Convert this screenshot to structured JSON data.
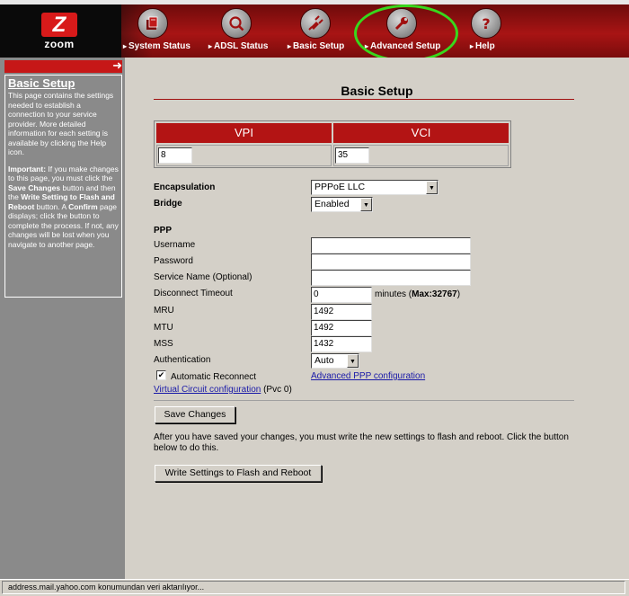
{
  "brand": {
    "logo_letter": "Z",
    "logo_word": "zoom"
  },
  "nav": [
    {
      "label": "System Status",
      "icon": "document-folder-icon"
    },
    {
      "label": "ADSL Status",
      "icon": "magnifier-icon"
    },
    {
      "label": "Basic Setup",
      "icon": "plug-icon"
    },
    {
      "label": "Advanced Setup",
      "icon": "wrench-icon"
    },
    {
      "label": "Help",
      "icon": "question-icon"
    }
  ],
  "sidebar": {
    "title": "Basic Setup",
    "intro": "This page contains the settings needed to establish a connection to your service provider. More detailed information for each setting is available by clicking the Help icon.",
    "important_label": "Important:",
    "important_1": " If you make changes to this page, you must click the ",
    "save_ref": "Save Changes",
    "important_2": " button and then the ",
    "write_ref": "Write Setting to Flash and Reboot",
    "important_3": " button. A ",
    "confirm_ref": "Confirm",
    "important_4": " page displays; click the button to complete the process. If not, any changes will be lost when you navigate to another page."
  },
  "main": {
    "title": "Basic Setup",
    "vpi_label": "VPI",
    "vpi_value": "8",
    "vci_label": "VCI",
    "vci_value": "35",
    "encapsulation_label": "Encapsulation",
    "encapsulation_value": "PPPoE LLC",
    "bridge_label": "Bridge",
    "bridge_value": "Enabled",
    "ppp_heading": "PPP",
    "username_label": "Username",
    "username_value": "",
    "password_label": "Password",
    "password_value": "",
    "service_label": "Service Name (Optional)",
    "service_value": "",
    "timeout_label": "Disconnect Timeout",
    "timeout_value": "0",
    "timeout_units": "minutes (",
    "timeout_max": "Max:32767",
    "timeout_close": ")",
    "mru_label": "MRU",
    "mru_value": "1492",
    "mtu_label": "MTU",
    "mtu_value": "1492",
    "mss_label": "MSS",
    "mss_value": "1432",
    "auth_label": "Authentication",
    "auth_value": "Auto",
    "auto_reconnect_label": "Automatic Reconnect",
    "auto_reconnect_checked": "✔",
    "advanced_ppp_link": "Advanced PPP configuration",
    "vc_link": "Virtual Circuit configuration",
    "vc_suffix": " (Pvc 0)",
    "save_button": "Save Changes",
    "flash_note": "After you have saved your changes, you must write the new settings to flash and reboot. Click the button below to do this.",
    "flash_button": "Write Settings to Flash and Reboot"
  },
  "status_bar": {
    "text": "address.mail.yahoo.com konumundan veri aktarılıyor..."
  },
  "colors": {
    "header_red": "#a81414",
    "highlight_green": "#38d81c",
    "sidebar_gray": "#8a8a8a",
    "link_blue": "#1a1aa8"
  }
}
